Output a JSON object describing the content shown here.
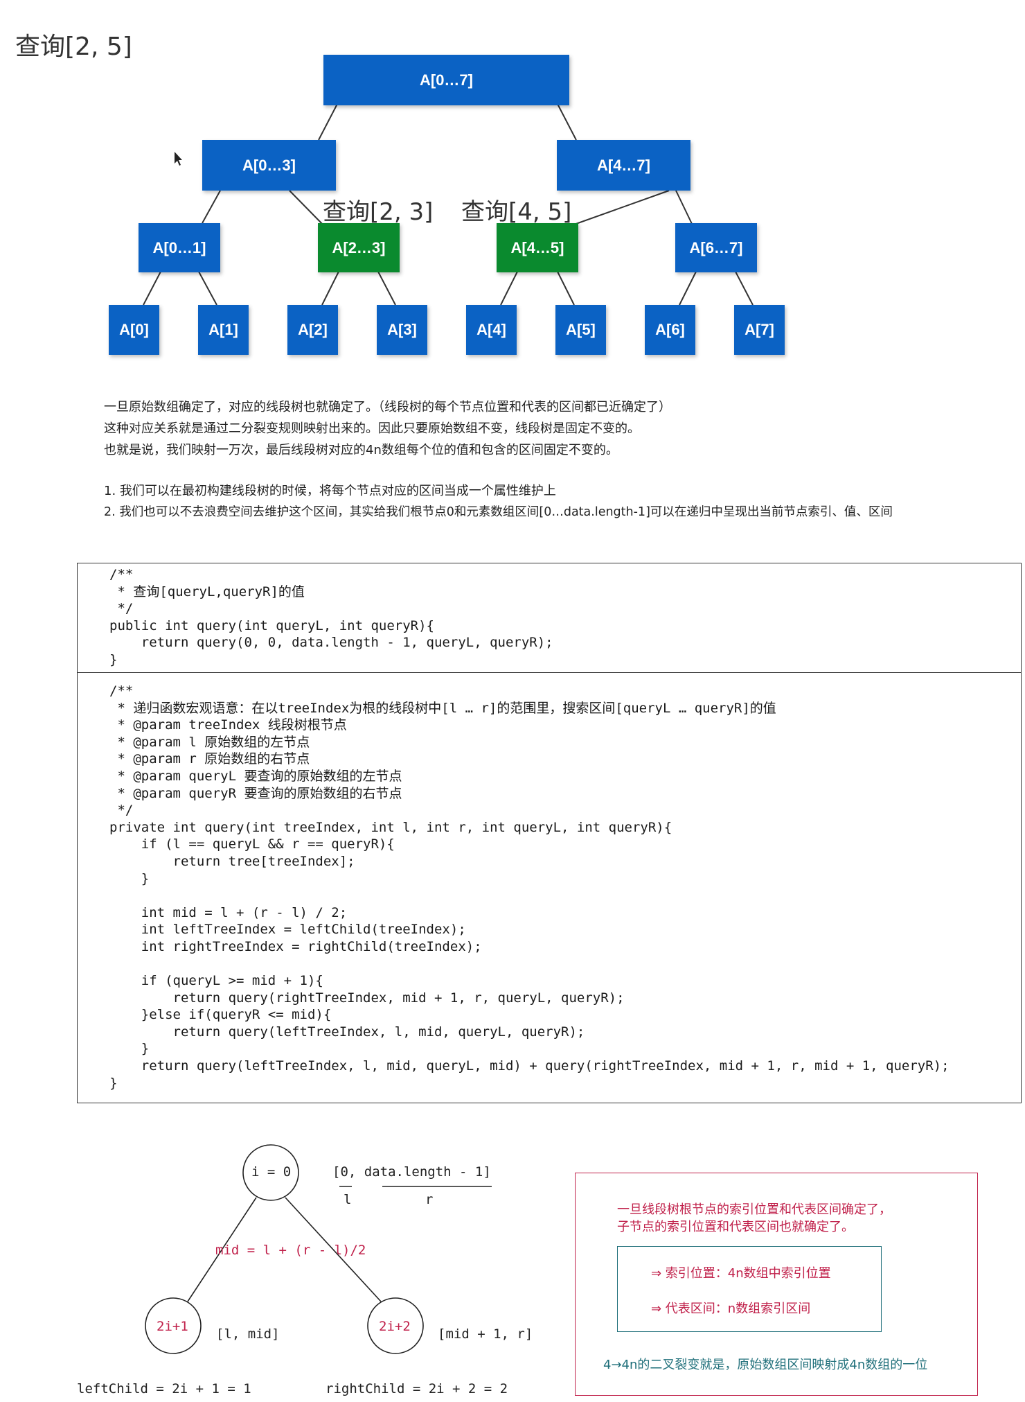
{
  "title": "查询[2, 5]",
  "tree": {
    "root": "A[0…7]",
    "level1": [
      "A[0…3]",
      "A[4…7]"
    ],
    "level2": [
      "A[0…1]",
      "A[2…3]",
      "A[4…5]",
      "A[6…7]"
    ],
    "leaves": [
      "A[0]",
      "A[1]",
      "A[2]",
      "A[3]",
      "A[4]",
      "A[5]",
      "A[6]",
      "A[7]"
    ],
    "query_left": "查询[2, 3]",
    "query_right": "查询[4, 5]",
    "colors": {
      "node": "#0b62c4",
      "highlight": "#0a8a2e"
    }
  },
  "paragraphs": [
    "一旦原始数组确定了，对应的线段树也就确定了。（线段树的每个节点位置和代表的区间都已近确定了）",
    "这种对应关系就是通过二分裂变规则映射出来的。因此只要原始数组不变，线段树是固定不变的。",
    "也就是说，我们映射一万次，最后线段树对应的4n数组每个位的值和包含的区间固定不变的。"
  ],
  "list": [
    "1. 我们可以在最初构建线段树的时候，将每个节点对应的区间当成一个属性维护上",
    "2. 我们也可以不去浪费空间去维护这个区间，其实给我们根节点0和元素数组区间[0…data.length-1]可以在递归中呈现出当前节点索引、值、区间"
  ],
  "code_public": "/**\n * 查询[queryL,queryR]的值\n */\npublic int query(int queryL, int queryR){\n    return query(0, 0, data.length - 1, queryL, queryR);\n}",
  "code_private": "/**\n * 递归函数宏观语意：在以treeIndex为根的线段树中[l … r]的范围里，搜索区间[queryL … queryR]的值\n * @param treeIndex 线段树根节点\n * @param l 原始数组的左节点\n * @param r 原始数组的右节点\n * @param queryL 要查询的原始数组的左节点\n * @param queryR 要查询的原始数组的右节点\n */\nprivate int query(int treeIndex, int l, int r, int queryL, int queryR){\n    if (l == queryL && r == queryR){\n        return tree[treeIndex];\n    }\n\n    int mid = l + (r - l) / 2;\n    int leftTreeIndex = leftChild(treeIndex);\n    int rightTreeIndex = rightChild(treeIndex);\n\n    if (queryL >= mid + 1){\n        return query(rightTreeIndex, mid + 1, r, queryL, queryR);\n    }else if(queryR <= mid){\n        return query(leftTreeIndex, l, mid, queryL, queryR);\n    }\n    return query(leftTreeIndex, l, mid, queryL, mid) + query(rightTreeIndex, mid + 1, r, mid + 1, queryR);\n}",
  "diagram": {
    "root_label": "i = 0",
    "range": "[0, data.length - 1]",
    "l_label": "l",
    "r_label": "r",
    "mid_formula": "mid = l + (r - l)/2",
    "left_node": "2i+1",
    "right_node": "2i+2",
    "left_range": "[l, mid]",
    "right_range": "[mid + 1, r]",
    "left_child": "leftChild = 2i + 1 = 1",
    "right_child": "rightChild = 2i + 2 = 2"
  },
  "note": {
    "line1": "一旦线段树根节点的索引位置和代表区间确定了，",
    "line2": "子节点的索引位置和代表区间也就确定了。",
    "item1": "⇒ 索引位置：4n数组中索引位置",
    "item2": "⇒ 代表区间：n数组索引区间",
    "footer": "4→4n的二叉裂变就是，原始数组区间映射成4n数组的一位",
    "colors": {
      "accent": "#c0204a",
      "teal": "#1f6f7a"
    }
  }
}
